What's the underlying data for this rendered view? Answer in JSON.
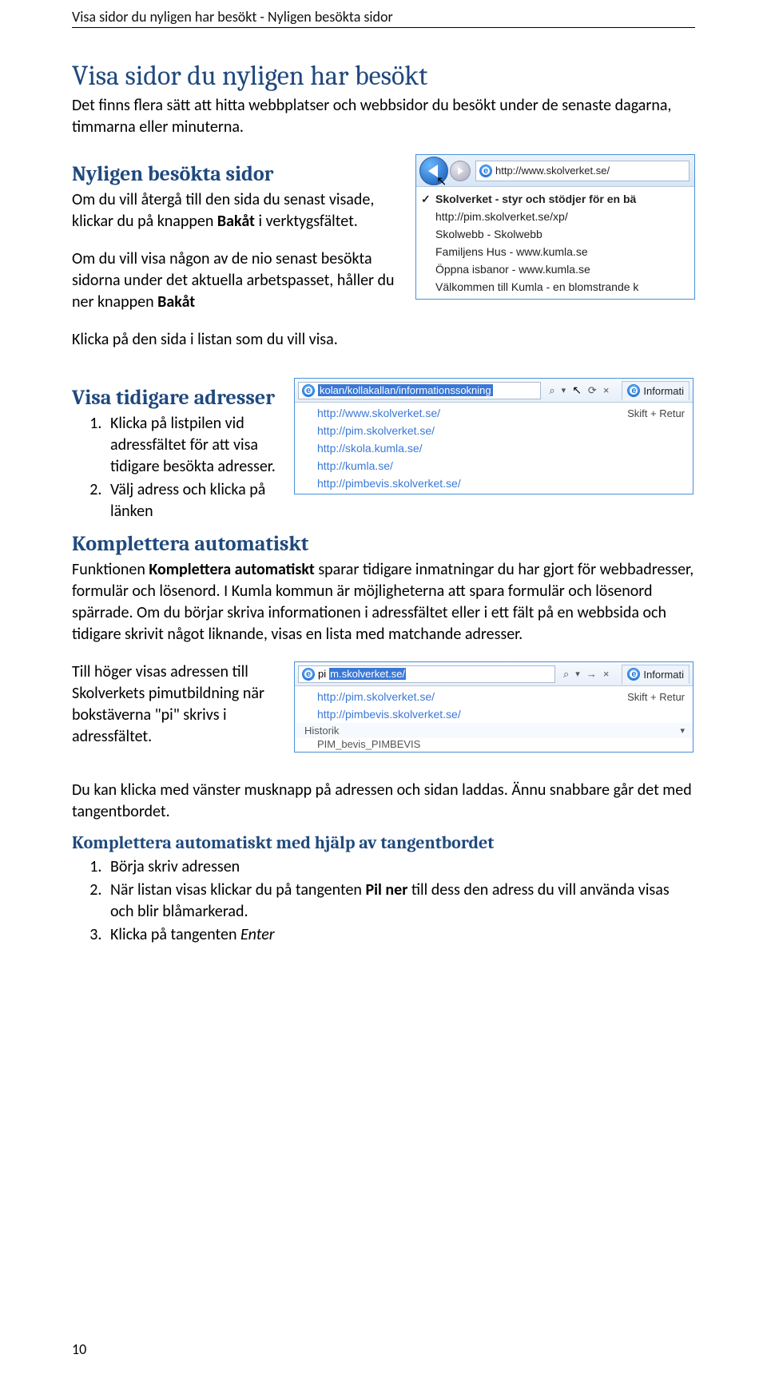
{
  "header": "Visa sidor du nyligen har besökt - Nyligen besökta sidor",
  "title": "Visa sidor du nyligen har besökt",
  "intro": "Det finns flera sätt att hitta webbplatser och webbsidor du besökt under de senaste dagarna, timmarna eller minuterna.",
  "sec1": {
    "heading": "Nyligen besökta sidor",
    "p1a": "Om du vill återgå till den sida du senast visade, klickar du på knappen ",
    "p1b": "Bakåt",
    "p1c": " i verktygsfältet.",
    "p2a": "Om du vill visa någon av de nio senast besökta sidorna under det aktuella arbetspasset, håller du ner knappen ",
    "p2b": "Bakåt",
    "p3": "Klicka på den sida i listan som du vill visa."
  },
  "shot1": {
    "url": "http://www.skolverket.se/",
    "items": [
      "Skolverket - styr och stödjer för en bä",
      "http://pim.skolverket.se/xp/",
      "Skolwebb - Skolwebb",
      "Familjens Hus - www.kumla.se",
      "Öppna isbanor - www.kumla.se",
      "Välkommen till Kumla - en blomstrande k"
    ]
  },
  "sec2": {
    "heading": "Visa tidigare adresser",
    "li1": "Klicka på listpilen vid adressfältet för att visa tidigare besökta adresser.",
    "li2": "Välj adress och klicka på länken"
  },
  "shot2": {
    "addr_sel": "kolan/kollakallan/informationssokning",
    "tab": "Informati",
    "search_icon": "⌕",
    "rows": [
      {
        "url": "http://www.skolverket.se/",
        "hint": "Skift + Retur"
      },
      {
        "url": "http://pim.skolverket.se/",
        "hint": ""
      },
      {
        "url": "http://skola.kumla.se/",
        "hint": ""
      },
      {
        "url": "http://kumla.se/",
        "hint": ""
      },
      {
        "url": "http://pimbevis.skolverket.se/",
        "hint": ""
      }
    ]
  },
  "sec3": {
    "heading": "Komplettera automatiskt",
    "p1a": "Funktionen ",
    "p1b": "Komplettera automatiskt",
    "p1c": " sparar tidigare inmatningar du har gjort för webbadresser, formulär och lösenord. I Kumla kommun är möjligheterna att spara formulär och lösenord spärrade. Om du börjar skriva informationen i adressfältet eller i ett fält på en webbsida och tidigare skrivit något liknande, visas en lista med matchande adresser.",
    "p2": "Till höger visas adressen till Skolverkets pimutbildning när bokstäverna \"pi\" skrivs i adressfältet."
  },
  "shot3": {
    "typed": "pi",
    "sel": "m.skolverket.se/",
    "tab": "Informati",
    "rows": [
      {
        "url": "http://pim.skolverket.se/",
        "hint": "Skift + Retur"
      },
      {
        "url": "http://pimbevis.skolverket.se/",
        "hint": ""
      }
    ],
    "section_label": "Historik",
    "small": "PIM_bevis_PIMBEVIS"
  },
  "sec4": {
    "p1": "Du kan klicka med vänster musknapp på adressen och sidan laddas. Ännu snabbare går det med tangentbordet.",
    "heading": "Komplettera automatiskt med hjälp av tangentbordet",
    "li1": "Börja skriv adressen",
    "li2a": "När listan visas klickar du på tangenten ",
    "li2b": "Pil ner",
    "li2c": " till dess den adress du vill använda visas och blir blåmarkerad.",
    "li3a": "Klicka på tangenten ",
    "li3b": "Enter"
  },
  "icons": {
    "magnify": "⌕",
    "refresh": "⟳",
    "close": "×",
    "down": "▾",
    "cursor": "↖",
    "right_arrow": "→"
  },
  "page_num": "10"
}
